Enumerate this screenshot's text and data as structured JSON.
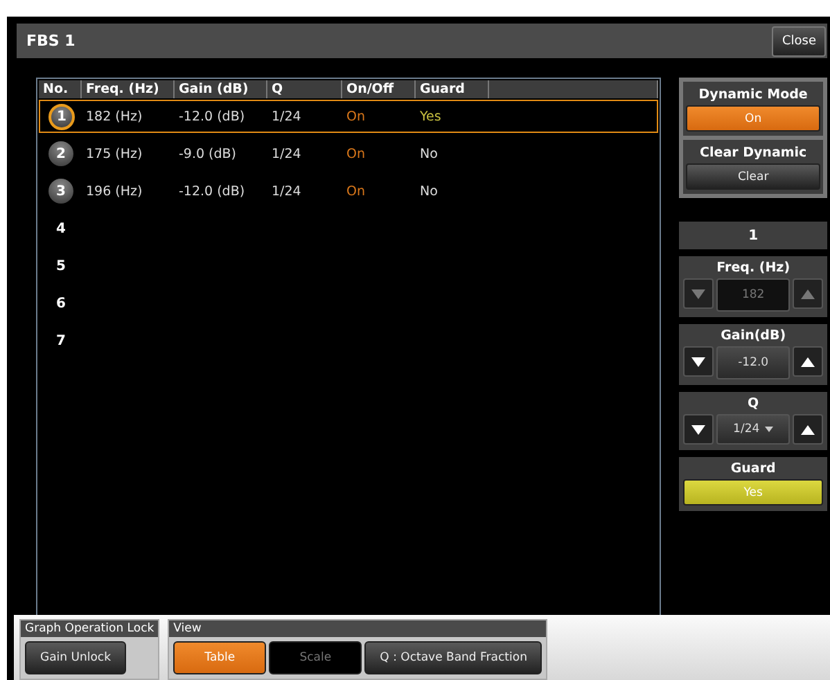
{
  "window": {
    "title": "FBS 1",
    "close": "Close"
  },
  "table": {
    "columns": [
      "No.",
      "Freq. (Hz)",
      "Gain (dB)",
      "Q",
      "On/Off",
      "Guard"
    ],
    "rows": [
      {
        "no": "1",
        "active": true,
        "selected": true,
        "freq": "182 (Hz)",
        "gain": "-12.0 (dB)",
        "q": "1/24",
        "onoff": "On",
        "guard": "Yes",
        "guard_on": true
      },
      {
        "no": "2",
        "active": true,
        "selected": false,
        "freq": "175 (Hz)",
        "gain": "-9.0 (dB)",
        "q": "1/24",
        "onoff": "On",
        "guard": "No",
        "guard_on": false
      },
      {
        "no": "3",
        "active": true,
        "selected": false,
        "freq": "196 (Hz)",
        "gain": "-12.0 (dB)",
        "q": "1/24",
        "onoff": "On",
        "guard": "No",
        "guard_on": false
      },
      {
        "no": "4",
        "active": false,
        "selected": false
      },
      {
        "no": "5",
        "active": false,
        "selected": false
      },
      {
        "no": "6",
        "active": false,
        "selected": false
      },
      {
        "no": "7",
        "active": false,
        "selected": false
      }
    ]
  },
  "side": {
    "dynamic_mode": {
      "label": "Dynamic Mode",
      "button": "On",
      "on": true
    },
    "clear_dynamic": {
      "label": "Clear Dynamic",
      "button": "Clear"
    },
    "band": "1",
    "params": [
      {
        "kind": "stepper",
        "label": "Freq. (Hz)",
        "value": "182",
        "disabled": true
      },
      {
        "kind": "stepper",
        "label": "Gain(dB)",
        "value": "-12.0",
        "disabled": false
      },
      {
        "kind": "dropdown",
        "label": "Q",
        "value": "1/24",
        "disabled": false
      }
    ],
    "guard": {
      "label": "Guard",
      "button": "Yes",
      "on": true
    }
  },
  "bottom": {
    "groups": [
      {
        "title": "Graph Operation Lock",
        "buttons": [
          {
            "label": "Gain Unlock",
            "selected": false,
            "disabled": false
          }
        ]
      },
      {
        "title": "View",
        "buttons": [
          {
            "label": "Table",
            "selected": true,
            "disabled": false
          },
          {
            "label": "Scale",
            "selected": false,
            "disabled": true
          },
          {
            "label": "Q : Octave Band Fraction",
            "selected": false,
            "disabled": false
          }
        ]
      }
    ]
  }
}
